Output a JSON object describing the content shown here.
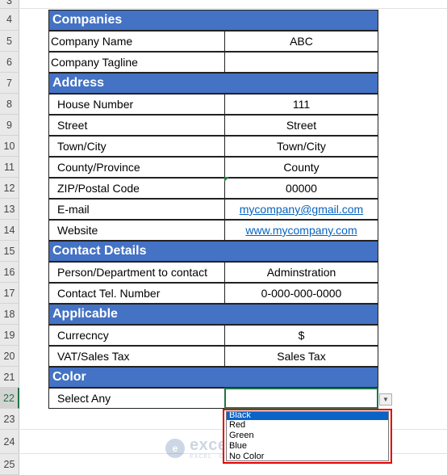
{
  "row_numbers": [
    "3",
    "4",
    "5",
    "6",
    "7",
    "8",
    "9",
    "10",
    "11",
    "12",
    "13",
    "14",
    "15",
    "16",
    "17",
    "18",
    "19",
    "20",
    "21",
    "22",
    "23",
    "24",
    "25"
  ],
  "active_row": "22",
  "sections": {
    "companies": "Companies",
    "address": "Address",
    "contact": "Contact Details",
    "applicable": "Applicable",
    "color": "Color"
  },
  "rows": {
    "company_name": {
      "label": "Company Name",
      "value": "ABC"
    },
    "company_tagline": {
      "label": "Company Tagline",
      "value": ""
    },
    "house_number": {
      "label": "House Number",
      "value": "111"
    },
    "street": {
      "label": "Street",
      "value": "Street"
    },
    "town": {
      "label": "Town/City",
      "value": "Town/City"
    },
    "county": {
      "label": "County/Province",
      "value": "County"
    },
    "zip": {
      "label": "ZIP/Postal Code",
      "value": "00000"
    },
    "email": {
      "label": "E-mail",
      "value": "mycompany@gmail.com"
    },
    "website": {
      "label": "Website",
      "value": "www.mycompany.com"
    },
    "person": {
      "label": "Person/Department to contact",
      "value": "Adminstration"
    },
    "tel": {
      "label": "Contact Tel. Number",
      "value": "0-000-000-0000"
    },
    "currency": {
      "label": "Currecncy",
      "value": "$"
    },
    "vat": {
      "label": "VAT/Sales Tax",
      "value": "Sales Tax"
    },
    "select": {
      "label": "Select Any",
      "value": ""
    }
  },
  "dropdown": {
    "options": [
      "Black",
      "Red",
      "Green",
      "Blue",
      "No Color"
    ],
    "highlighted": "Black",
    "arrow": "▼"
  },
  "watermark": {
    "logo": "e",
    "name": "exceldemy",
    "tagline": "EXCEL · DATA · BI"
  },
  "colors": {
    "section_bg": "#4472c4",
    "link": "#0563c1",
    "active_border": "#217346",
    "highlight_box": "#e00000",
    "list_selection": "#0a64c8"
  }
}
